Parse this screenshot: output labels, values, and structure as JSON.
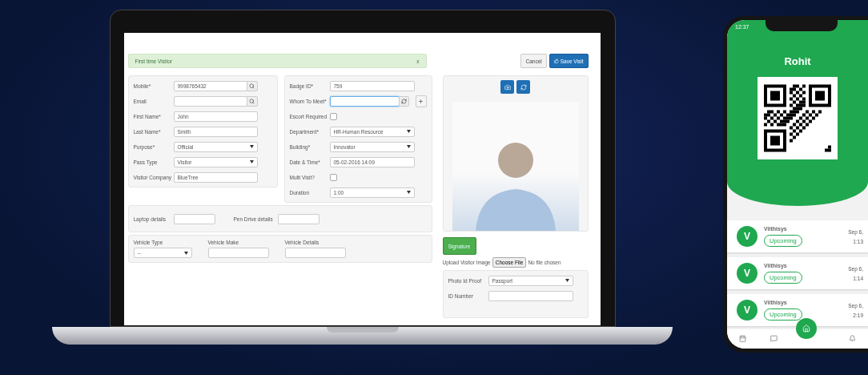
{
  "visitor_form": {
    "alert": {
      "text": "First time Visitor",
      "close": "x"
    },
    "buttons": [
      {
        "kind": "cancel",
        "label": "Cancel"
      },
      {
        "kind": "save",
        "label": "Save Visit"
      }
    ],
    "left_fields": [
      {
        "kind": "search",
        "label": "Mobile*",
        "value": "9998765432"
      },
      {
        "kind": "search",
        "label": "Email"
      },
      {
        "kind": "text",
        "label": "First Name*",
        "value": "John"
      },
      {
        "kind": "text",
        "label": "Last Name*",
        "value": "Smith"
      },
      {
        "kind": "select",
        "label": "Purpose*",
        "value": "Official"
      },
      {
        "kind": "select",
        "label": "Pass Type",
        "value": "Visitor"
      },
      {
        "kind": "text",
        "label": "Visitor Company",
        "value": "BlueTree"
      }
    ],
    "right_fields": [
      {
        "kind": "text",
        "label": "Badge ID*",
        "value": "759"
      },
      {
        "kind": "lookup",
        "label": "Whom To Meet*",
        "focused": true
      },
      {
        "kind": "checkbox",
        "label": "Escort Required",
        "checked": false
      },
      {
        "kind": "select",
        "label": "Department*",
        "value": "HR-Human Resource"
      },
      {
        "kind": "select",
        "label": "Building*",
        "value": "Innovator"
      },
      {
        "kind": "text",
        "label": "Date & Time*",
        "value": "05-02-2016 14:09"
      },
      {
        "kind": "checkbox",
        "label": "Multi Visit?",
        "checked": false
      },
      {
        "kind": "select",
        "label": "Duration",
        "value": "1:00"
      }
    ],
    "devices": [
      {
        "label": "Laptop details"
      },
      {
        "label": "Pen Drive details"
      }
    ],
    "vehicle": [
      {
        "kind": "select",
        "label": "Vehicle Type",
        "value": "--"
      },
      {
        "kind": "text",
        "label": "Vehicle Make"
      },
      {
        "kind": "text",
        "label": "Vehicle Details"
      }
    ],
    "signature_button": "Signature",
    "upload": {
      "label": "Upload Visitor Image",
      "button": "Choose File",
      "status": "No file chosen"
    },
    "id_fields": [
      {
        "kind": "select",
        "label": "Photo Id Proof",
        "value": "Passport"
      },
      {
        "kind": "text",
        "label": "ID Number"
      }
    ]
  },
  "phone": {
    "time": "12:37",
    "name": "Rohit",
    "visits": [
      {
        "initial": "V",
        "name": "Viithisys",
        "status": "Upcoming",
        "date": "Sep 6,",
        "time": "1:13"
      },
      {
        "initial": "V",
        "name": "Viithisys",
        "status": "Upcoming",
        "date": "Sep 6,",
        "time": "1:14"
      },
      {
        "initial": "V",
        "name": "Viithisys",
        "status": "Upcoming",
        "date": "Sep 6,",
        "time": "2:19"
      }
    ]
  }
}
